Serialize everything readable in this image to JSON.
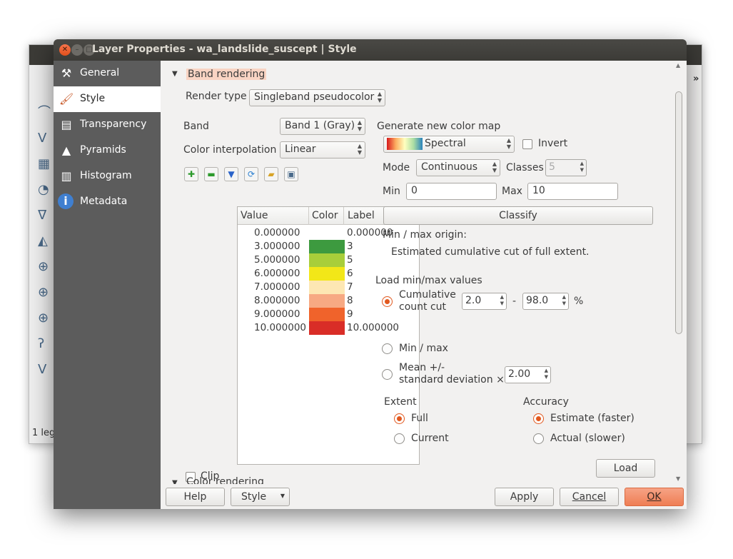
{
  "bg_app": {
    "status_text": "1 leg",
    "chevron": "»"
  },
  "dialog": {
    "title": "Layer Properties - wa_landslide_suscept | Style",
    "window_buttons": {
      "close": "✕",
      "minimize": "–",
      "maximize": "□"
    }
  },
  "sidebar": {
    "items": [
      {
        "label": "General",
        "icon": "wrench-hammer-icon",
        "glyph": "⚒"
      },
      {
        "label": "Style",
        "icon": "paintbrush-icon",
        "glyph": "🖌"
      },
      {
        "label": "Transparency",
        "icon": "transparency-icon",
        "glyph": "▤"
      },
      {
        "label": "Pyramids",
        "icon": "pyramids-icon",
        "glyph": "▲"
      },
      {
        "label": "Histogram",
        "icon": "histogram-icon",
        "glyph": "▥"
      },
      {
        "label": "Metadata",
        "icon": "info-icon",
        "glyph": "i"
      }
    ],
    "active_index": 1
  },
  "band_rendering": {
    "section_title": "Band rendering",
    "render_type_label": "Render type",
    "render_type_value": "Singleband pseudocolor",
    "band_label": "Band",
    "band_value": "Band 1 (Gray)",
    "interp_label": "Color interpolation",
    "interp_value": "Linear",
    "toolbar_icons": [
      "add-class-icon",
      "remove-class-icon",
      "load-from-band-icon",
      "refresh-icon",
      "open-file-icon",
      "save-file-icon"
    ],
    "table": {
      "headers": [
        "Value",
        "Color",
        "Label"
      ],
      "rows": [
        {
          "value": "0.000000",
          "color": "#ffffff",
          "label": "0.000000"
        },
        {
          "value": "3.000000",
          "color": "#3d9a3f",
          "label": "3"
        },
        {
          "value": "5.000000",
          "color": "#a8ce3a",
          "label": "5"
        },
        {
          "value": "6.000000",
          "color": "#f2e718",
          "label": "6"
        },
        {
          "value": "7.000000",
          "color": "#fde7b3",
          "label": "7"
        },
        {
          "value": "8.000000",
          "color": "#f7a983",
          "label": "8"
        },
        {
          "value": "9.000000",
          "color": "#f0632b",
          "label": "9"
        },
        {
          "value": "10.000000",
          "color": "#d92d27",
          "label": "10.000000"
        }
      ]
    },
    "clip_label": "Clip"
  },
  "color_map": {
    "title": "Generate new color map",
    "ramp_value": "Spectral",
    "invert_label": "Invert",
    "mode_label": "Mode",
    "mode_value": "Continuous",
    "classes_label": "Classes",
    "classes_value": "5",
    "min_label": "Min",
    "min_value": "0",
    "max_label": "Max",
    "max_value": "10",
    "classify_label": "Classify",
    "origin_label": "Min / max origin:",
    "origin_value": "Estimated cumulative cut of full extent."
  },
  "load_minmax": {
    "title": "Load min/max values",
    "cumulative_line1": "Cumulative",
    "cumulative_line2": "count cut",
    "cut_low": "2.0",
    "dash": "-",
    "cut_high": "98.0",
    "percent": "%",
    "minmax_label": "Min / max",
    "mean_line1": "Mean +/-",
    "mean_line2": "standard deviation ×",
    "stddev_value": "2.00",
    "extent_label": "Extent",
    "extent_full": "Full",
    "extent_current": "Current",
    "accuracy_label": "Accuracy",
    "accuracy_estimate": "Estimate (faster)",
    "accuracy_actual": "Actual (slower)",
    "load_label": "Load"
  },
  "color_rendering": {
    "section_title": "Color rendering"
  },
  "footer": {
    "help": "Help",
    "style": "Style",
    "apply": "Apply",
    "cancel": "Cancel",
    "ok": "OK"
  },
  "colors": {
    "accent": "#e2581e",
    "sidebar_bg": "#5c5c5c",
    "section_highlight": "#f9d4c3"
  }
}
